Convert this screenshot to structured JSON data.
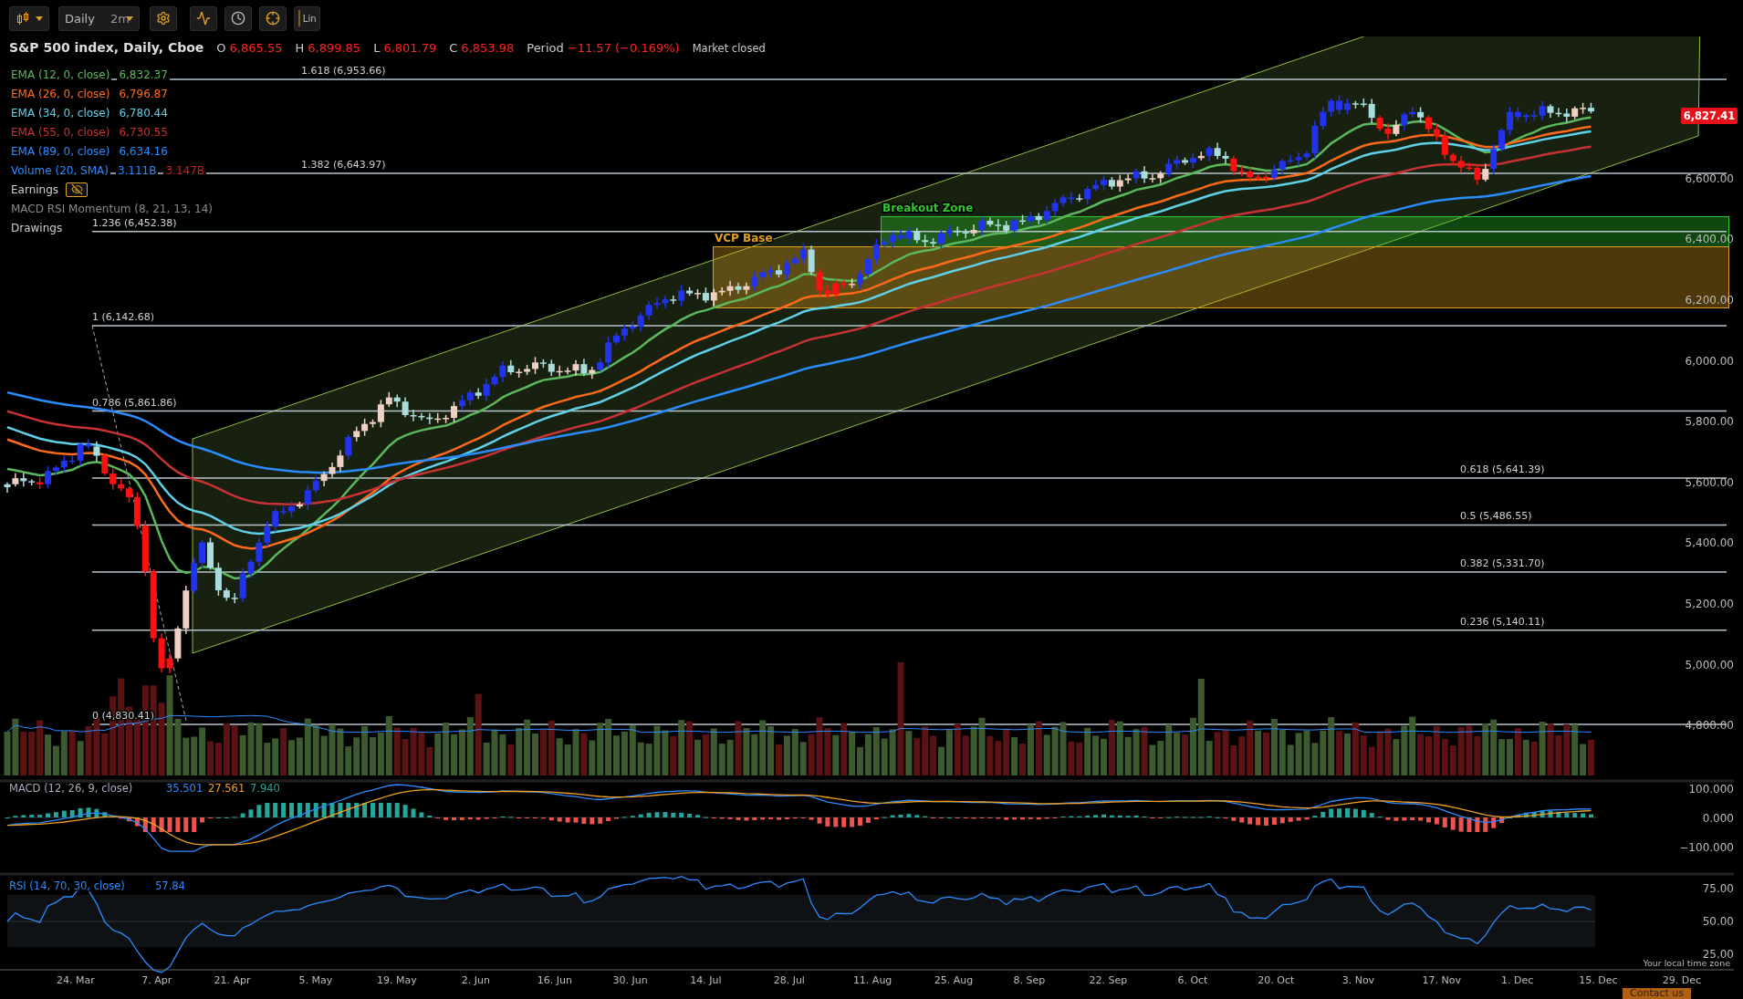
{
  "toolbar": {
    "interval": "Daily",
    "range": "2m",
    "scale": "Lin"
  },
  "header": {
    "title": "S&P 500 index, Daily, Cboe",
    "quotes": [
      {
        "label": "O",
        "value": "6,865.55"
      },
      {
        "label": "H",
        "value": "6,899.85"
      },
      {
        "label": "L",
        "value": "6,801.79"
      },
      {
        "label": "C",
        "value": "6,853.98"
      }
    ],
    "period_label": "Period",
    "period_change": "−11.57 (−0.169%)",
    "status": "Market closed"
  },
  "legend": [
    {
      "kind": "study",
      "label": "EMA (12, 0, close)",
      "color": "#5cb85c",
      "values": [
        {
          "text": "6,832.37",
          "color": "#5cb85c"
        }
      ]
    },
    {
      "kind": "study",
      "label": "EMA (26, 0, close)",
      "color": "#ff6a1a",
      "values": [
        {
          "text": "6,796.87",
          "color": "#ff6a1a"
        }
      ]
    },
    {
      "kind": "study",
      "label": "EMA (34, 0, close)",
      "color": "#5fd0e8",
      "values": [
        {
          "text": "6,780.44",
          "color": "#5fd0e8"
        }
      ]
    },
    {
      "kind": "study",
      "label": "EMA (55, 0, close)",
      "color": "#c83232",
      "values": [
        {
          "text": "6,730.55",
          "color": "#c83232"
        }
      ]
    },
    {
      "kind": "study",
      "label": "EMA (89, 0, close)",
      "color": "#2a8cff",
      "values": [
        {
          "text": "6,634.16",
          "color": "#2a8cff"
        }
      ]
    },
    {
      "kind": "study",
      "label": "Volume (20, SMA)",
      "color": "#2a8cff",
      "values": [
        {
          "text": "3.111B",
          "color": "#2a8cff"
        },
        {
          "text": "3.147B",
          "color": "#d02020"
        }
      ]
    },
    {
      "kind": "toggle",
      "label": "Earnings",
      "color": "#d0d0d0",
      "visible": false
    },
    {
      "kind": "study",
      "label": "MACD RSI Momentum (8, 21, 13, 14)",
      "color": "#8a8a8a"
    },
    {
      "kind": "plain",
      "label": "Drawings",
      "color": "#d0d0d0"
    }
  ],
  "fib_levels": [
    "1.618 (6,953.66)",
    "1.382 (6,643.97)",
    "1.236 (6,452.38)",
    "1 (6,142.68)",
    "0.786 (5,861.86)",
    "0.618 (5,641.39)",
    "0.5 (5,486.55)",
    "0.382 (5,331.70)",
    "0.236 (5,140.11)",
    "0 (4,830.41)"
  ],
  "zones": [
    {
      "label": "Breakout Zone",
      "color": "#2ec82e"
    },
    {
      "label": "VCP Base",
      "color": "#e0a020"
    }
  ],
  "price_axis": [
    "6,600.00",
    "6,400.00",
    "6,200.00",
    "6,000.00",
    "5,800.00",
    "5,600.00",
    "5,400.00",
    "5,200.00",
    "5,000.00",
    "4,800.00"
  ],
  "last_price": "6,827.41",
  "macd": {
    "label": "MACD (12, 26, 9, close)",
    "values": [
      {
        "text": "35.501",
        "color": "#2a8cff"
      },
      {
        "text": "27.561",
        "color": "#f0a020"
      },
      {
        "text": "7.940",
        "color": "#26a69a"
      }
    ],
    "axis": [
      "100.000",
      "0.000",
      "−100.000"
    ]
  },
  "rsi": {
    "label": "RSI (14, 70, 30, close)",
    "values": [
      {
        "text": "57.84",
        "color": "#2a8cff"
      }
    ],
    "axis": [
      "75.00",
      "50.00",
      "25.00"
    ]
  },
  "time_axis": [
    "24. Mar",
    "7. Apr",
    "21. Apr",
    "5. May",
    "19. May",
    "2. Jun",
    "16. Jun",
    "30. Jun",
    "14. Jul",
    "28. Jul",
    "11. Aug",
    "25. Aug",
    "8. Sep",
    "22. Sep",
    "6. Oct",
    "20. Oct",
    "3. Nov",
    "17. Nov",
    "1. Dec",
    "15. Dec",
    "29. Dec"
  ],
  "time_zone_note": "Your local time zone",
  "contact_button": "Contact us"
}
